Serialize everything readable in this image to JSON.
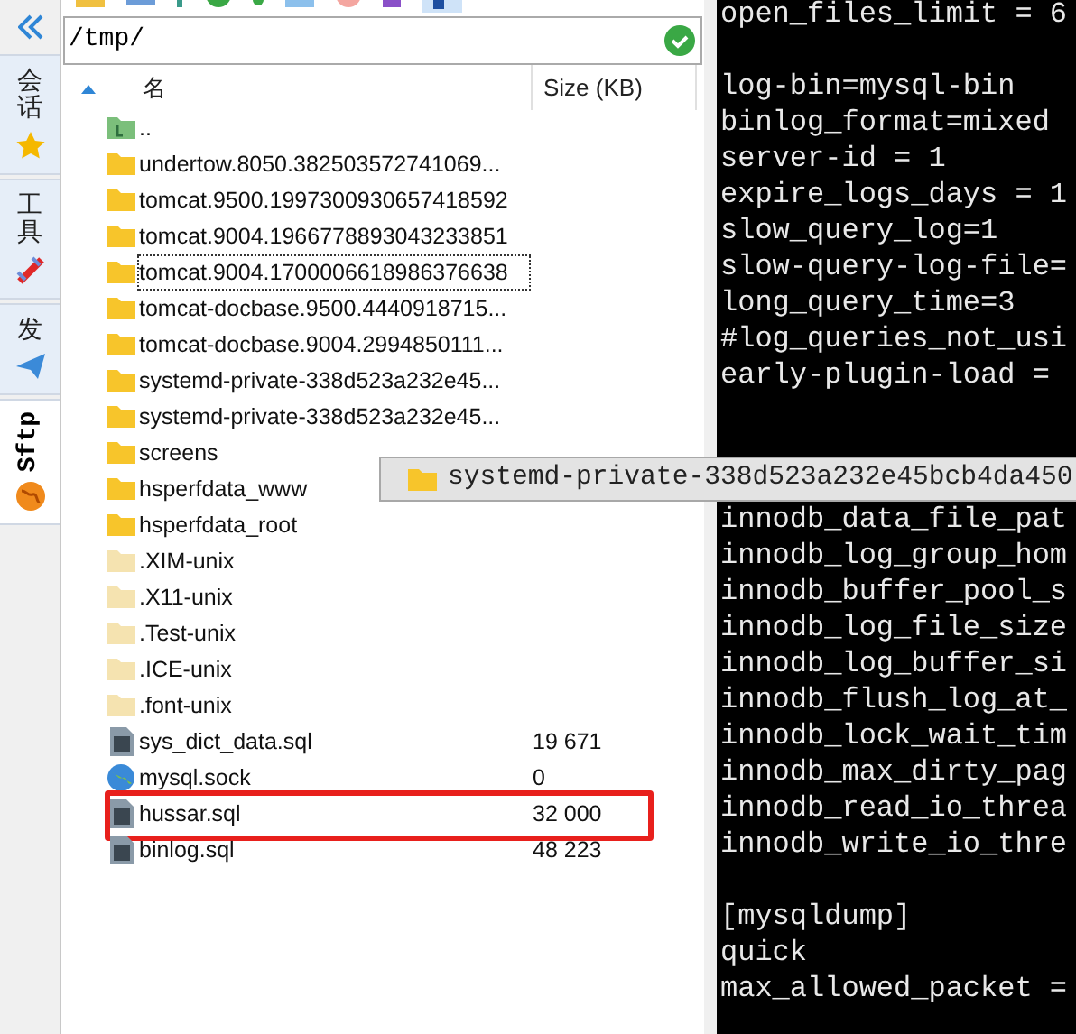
{
  "sidebar": {
    "tabs": [
      {
        "label": "会话",
        "kind": "star",
        "rotated": false,
        "selected": false
      },
      {
        "label": "工具",
        "kind": "tool",
        "rotated": false,
        "selected": false
      },
      {
        "label": "发",
        "kind": "plane",
        "rotated": false,
        "selected": false
      },
      {
        "label": "Sftp",
        "kind": "globe",
        "rotated": true,
        "selected": true
      }
    ]
  },
  "file_panel": {
    "path": "/tmp/",
    "columns": [
      "名",
      "Size (KB)"
    ],
    "rows": [
      {
        "name": "..",
        "kind": "parent",
        "focused": false,
        "highlighted": false
      },
      {
        "name": "undertow.8050.382503572741069...",
        "kind": "folder",
        "focused": false,
        "highlighted": false
      },
      {
        "name": "tomcat.9500.1997300930657418592",
        "kind": "folder",
        "focused": false,
        "highlighted": false
      },
      {
        "name": "tomcat.9004.1966778893043233851",
        "kind": "folder",
        "focused": false,
        "highlighted": false
      },
      {
        "name": "tomcat.9004.1700006618986376638",
        "kind": "folder",
        "focused": true,
        "highlighted": false
      },
      {
        "name": "tomcat-docbase.9500.4440918715...",
        "kind": "folder",
        "focused": false,
        "highlighted": false
      },
      {
        "name": "tomcat-docbase.9004.2994850111...",
        "kind": "folder",
        "focused": false,
        "highlighted": false
      },
      {
        "name": "systemd-private-338d523a232e45...",
        "kind": "folder",
        "focused": false,
        "highlighted": false
      },
      {
        "name": "systemd-private-338d523a232e45...",
        "kind": "folder",
        "focused": false,
        "highlighted": false
      },
      {
        "name": "screens",
        "kind": "folder",
        "focused": false,
        "highlighted": false
      },
      {
        "name": "hsperfdata_www",
        "kind": "folder",
        "focused": false,
        "highlighted": false
      },
      {
        "name": "hsperfdata_root",
        "kind": "folder",
        "focused": false,
        "highlighted": false
      },
      {
        "name": ".XIM-unix",
        "kind": "hidden_folder",
        "focused": false,
        "highlighted": false
      },
      {
        "name": ".X11-unix",
        "kind": "hidden_folder",
        "focused": false,
        "highlighted": false
      },
      {
        "name": ".Test-unix",
        "kind": "hidden_folder",
        "focused": false,
        "highlighted": false
      },
      {
        "name": ".ICE-unix",
        "kind": "hidden_folder",
        "focused": false,
        "highlighted": false
      },
      {
        "name": ".font-unix",
        "kind": "hidden_folder",
        "focused": false,
        "highlighted": false
      },
      {
        "name": "sys_dict_data.sql",
        "kind": "file",
        "size": "19 671",
        "focused": false,
        "highlighted": false
      },
      {
        "name": "mysql.sock",
        "kind": "socket",
        "size": "0",
        "focused": false,
        "highlighted": false
      },
      {
        "name": "hussar.sql",
        "kind": "file",
        "size": "32 000",
        "focused": false,
        "highlighted": true
      },
      {
        "name": "binlog.sql",
        "kind": "file",
        "size": "48 223",
        "focused": false,
        "highlighted": false
      }
    ],
    "tooltip": "systemd-private-338d523a232e45bcb4da450"
  },
  "terminal": {
    "blocks": [
      {
        "lines": [
          "open_files_limit = 6"
        ]
      },
      {
        "lines": [
          "log-bin=mysql-bin",
          "binlog_format=mixed",
          "server-id = 1",
          "expire_logs_days = 1",
          "slow_query_log=1",
          "slow-query-log-file=",
          "long_query_time=3",
          "#log_queries_not_usi",
          "early-plugin-load ="
        ]
      },
      {
        "lines": [
          "innodb_data_file_pat",
          "innodb_log_group_hom",
          "innodb_buffer_pool_s",
          "innodb_log_file_size",
          "innodb_log_buffer_si",
          "innodb_flush_log_at_",
          "innodb_lock_wait_tim",
          "innodb_max_dirty_pag",
          "innodb_read_io_threa",
          "innodb_write_io_thre"
        ]
      },
      {
        "lines": [
          "[mysqldump]",
          "quick",
          "max_allowed_packet ="
        ]
      }
    ]
  }
}
